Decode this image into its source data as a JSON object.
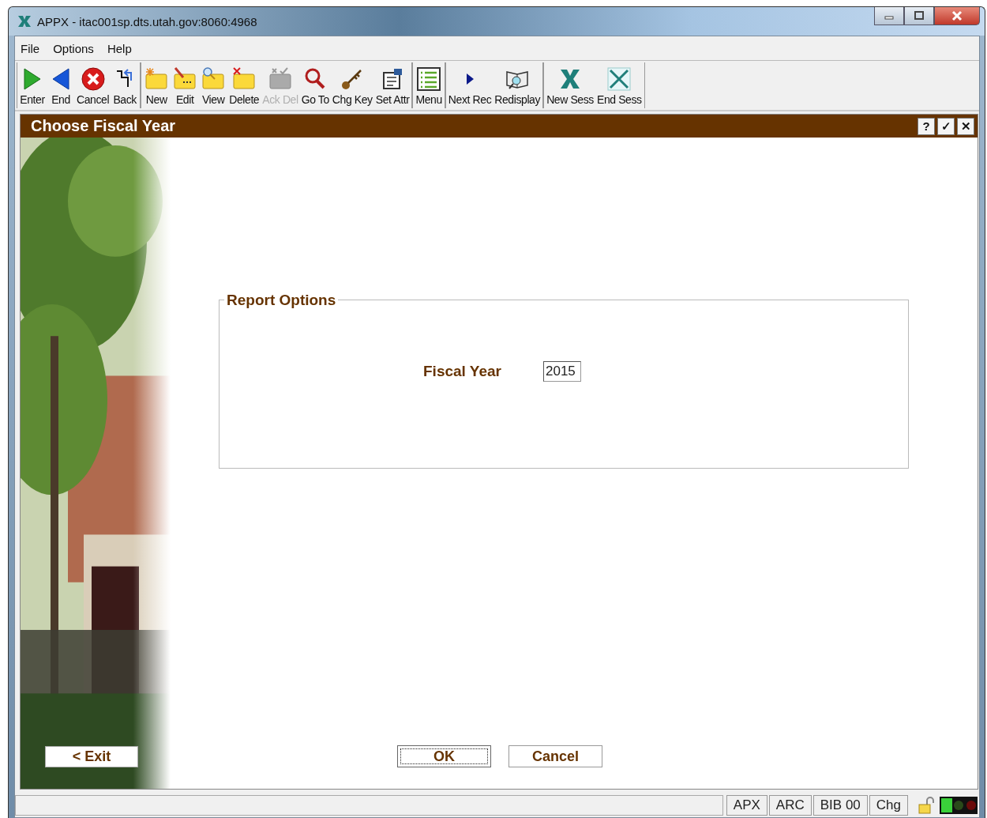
{
  "window": {
    "title": "APPX - itac001sp.dts.utah.gov:8060:4968"
  },
  "menu": [
    "File",
    "Options",
    "Help"
  ],
  "toolbar": [
    [
      {
        "label": "Enter",
        "kind": "enter",
        "disabled": false
      },
      {
        "label": "End",
        "kind": "end",
        "disabled": false
      },
      {
        "label": "Cancel",
        "kind": "cancel",
        "disabled": false
      },
      {
        "label": "Back",
        "kind": "back",
        "disabled": false
      }
    ],
    [
      {
        "label": "New",
        "kind": "new",
        "disabled": false
      },
      {
        "label": "Edit",
        "kind": "edit",
        "disabled": false
      },
      {
        "label": "View",
        "kind": "view",
        "disabled": false
      },
      {
        "label": "Delete",
        "kind": "delete",
        "disabled": false
      },
      {
        "label": "Ack Del",
        "kind": "ackdel",
        "disabled": true
      },
      {
        "label": "Go To",
        "kind": "goto",
        "disabled": false
      },
      {
        "label": "Chg Key",
        "kind": "key",
        "disabled": false
      },
      {
        "label": "Set Attr",
        "kind": "attr",
        "disabled": false
      }
    ],
    [
      {
        "label": "Menu",
        "kind": "menu",
        "disabled": false
      }
    ],
    [
      {
        "label": "Next Rec",
        "kind": "next",
        "disabled": false
      },
      {
        "label": "Redisplay",
        "kind": "redisplay",
        "disabled": false
      }
    ],
    [
      {
        "label": "New Sess",
        "kind": "newsess",
        "disabled": false
      },
      {
        "label": "End Sess",
        "kind": "endsess",
        "disabled": false
      }
    ]
  ],
  "screen": {
    "title": "Choose Fiscal Year",
    "header_buttons": [
      "?",
      "✓",
      "✕"
    ]
  },
  "exit_button": "< Exit",
  "group": {
    "title": "Report Options",
    "fields": [
      {
        "label": "Fiscal Year",
        "value": "2015"
      }
    ]
  },
  "buttons": [
    {
      "label": "OK",
      "focused": true
    },
    {
      "label": "Cancel",
      "focused": false
    }
  ],
  "status_bar": [
    "APX",
    "ARC",
    "BIB 00",
    "Chg"
  ]
}
